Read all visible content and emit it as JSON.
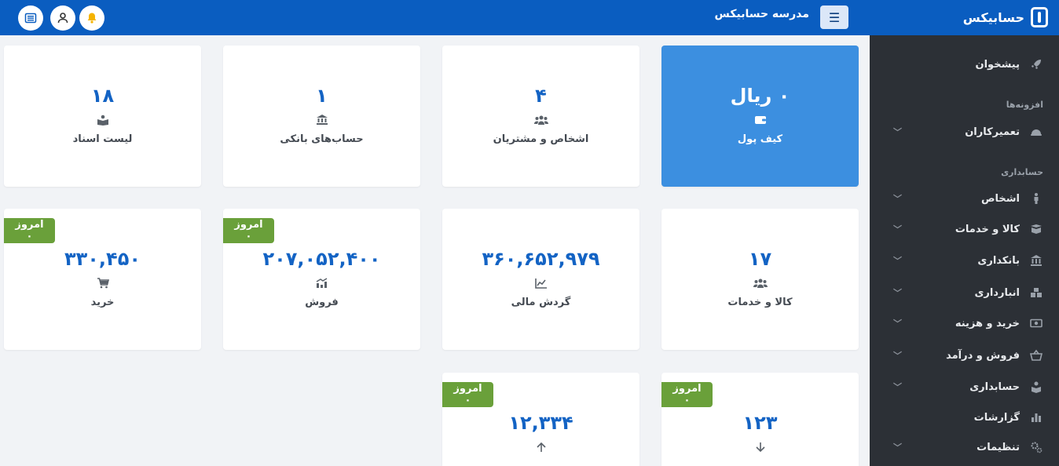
{
  "header": {
    "brand": "حسابیکس",
    "school_name": "مدرسه حسابیکس",
    "menu_icon": "hamburger-icon",
    "icons": [
      "bell-icon",
      "user-icon",
      "list-icon"
    ],
    "bell_color": "#f5b301"
  },
  "sidebar": {
    "dashboard": "پیشخوان",
    "section_addons": "افزونه‌ها",
    "repairers": "تعمیرکاران",
    "section_accounting": "حسابداری",
    "items": [
      {
        "label": "اشخاص",
        "icon": "person-icon"
      },
      {
        "label": "کالا و خدمات",
        "icon": "box-icon"
      },
      {
        "label": "بانکداری",
        "icon": "bank-icon"
      },
      {
        "label": "انبارداری",
        "icon": "warehouse-icon"
      },
      {
        "label": "خرید و هزینه",
        "icon": "money-icon"
      },
      {
        "label": "فروش و درآمد",
        "icon": "basket-icon"
      },
      {
        "label": "حسابداری",
        "icon": "accounting-icon"
      },
      {
        "label": "گزارشات",
        "icon": "chart-icon"
      },
      {
        "label": "تنظیمات",
        "icon": "gear-icon"
      }
    ]
  },
  "cards": {
    "wallet": {
      "value": "۰ ریال",
      "label": "کیف پول"
    },
    "people": {
      "value": "۴",
      "label": "اشخاص و مشتریان"
    },
    "banks": {
      "value": "۱",
      "label": "حساب‌های بانکی"
    },
    "docs": {
      "value": "۱۸",
      "label": "لیست اسناد"
    },
    "goods": {
      "value": "۱۷",
      "label": "کالا و خدمات"
    },
    "turnover": {
      "value": "۳۶۰,۶۵۲,۹۷۹",
      "label": "گردش مالی"
    },
    "sales": {
      "value": "۲۰۷,۰۵۲,۴۰۰",
      "label": "فروش",
      "badge": "امروز ۰"
    },
    "purchase": {
      "value": "۳۳۰,۴۵۰",
      "label": "خرید",
      "badge": "امروز ۰"
    },
    "received": {
      "value": "۱۲۳",
      "badge": "امروز ۰"
    },
    "paid": {
      "value": "۱۲,۳۳۴",
      "badge": "امروز ۰"
    }
  }
}
